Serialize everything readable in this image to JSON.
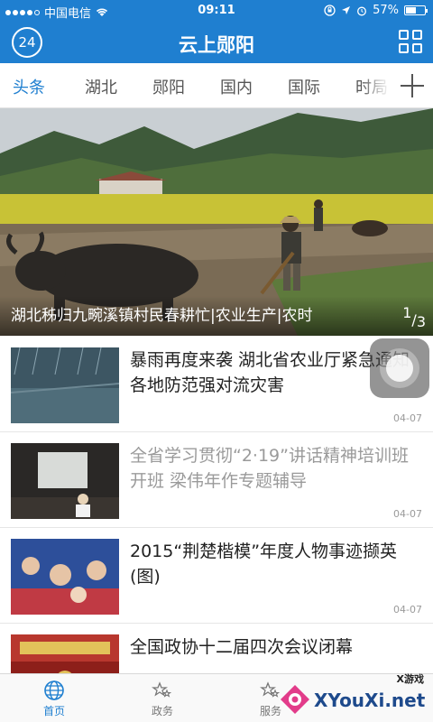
{
  "status": {
    "carrier": "中国电信",
    "time": "09:11",
    "battery": "57%",
    "battery_level": 0.57
  },
  "header": {
    "title": "云上郧阳",
    "logo_text": "24"
  },
  "tabs": [
    {
      "label": "头条",
      "active": true
    },
    {
      "label": "湖北"
    },
    {
      "label": "郧阳"
    },
    {
      "label": "国内"
    },
    {
      "label": "国际"
    },
    {
      "label": "时局"
    }
  ],
  "hero": {
    "caption": "湖北秭归九畹溪镇村民春耕忙|农业生产|农时",
    "page_current": "1",
    "page_total": "3"
  },
  "news": [
    {
      "headline": "暴雨再度来袭 湖北省农业厅紧急通知各地防范强对流灾害",
      "date": "04-07",
      "read": false
    },
    {
      "headline": "全省学习贯彻“2·19”讲话精神培训班开班 梁伟年作专题辅导",
      "date": "04-07",
      "read": true
    },
    {
      "headline": "2015“荆楚楷模”年度人物事迹撷英(图)",
      "date": "04-07",
      "read": false
    },
    {
      "headline": "全国政协十二届四次会议闭幕",
      "date": "",
      "read": false
    }
  ],
  "bottom_nav": [
    {
      "label": "首页",
      "icon": "globe-icon",
      "active": true
    },
    {
      "label": "政务",
      "icon": "stars-icon"
    },
    {
      "label": "服务",
      "icon": "stars-icon"
    }
  ],
  "watermark": {
    "text": "XYouXi.net",
    "small": "X游戏"
  },
  "colors": {
    "brand": "#1f7fd0"
  }
}
